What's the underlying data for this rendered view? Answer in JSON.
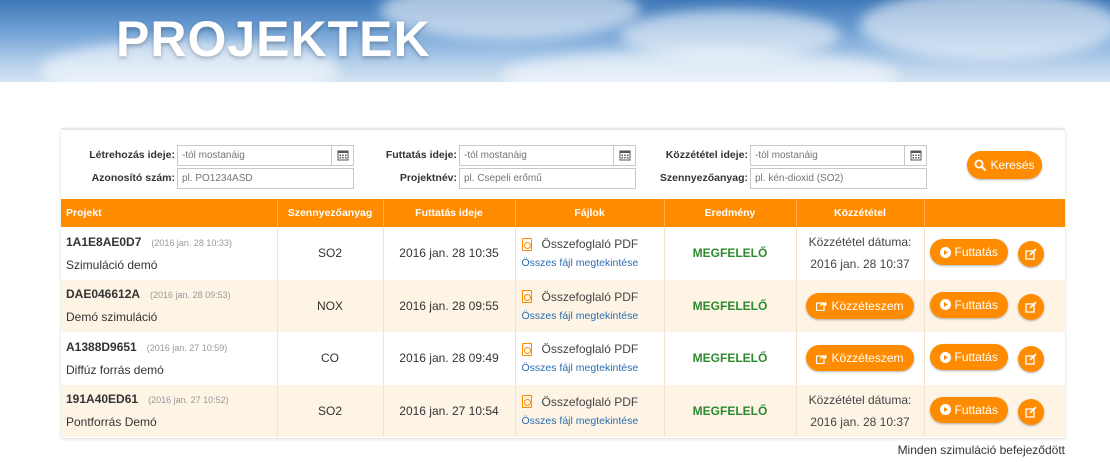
{
  "header": {
    "title": "PROJEKTEK"
  },
  "filters": {
    "created_label": "Létrehozás ideje:",
    "created_placeholder": "-tól mostanáig",
    "id_label": "Azonosító szám:",
    "id_placeholder": "pl. PO1234ASD",
    "run_label": "Futtatás ideje:",
    "run_placeholder": "-tól mostanáig",
    "name_label": "Projektnév:",
    "name_placeholder": "pl. Csepeli erőmű",
    "pub_label": "Közzététel ideje:",
    "pub_placeholder": "-tól mostanáig",
    "pollutant_label": "Szennyezőanyag:",
    "pollutant_placeholder": "pl. kén-dioxid (SO2)",
    "search_label": "Keresés"
  },
  "table": {
    "headers": {
      "project": "Projekt",
      "pollutant": "Szennyezőanyag",
      "run_time": "Futtatás ideje",
      "files": "Fájlok",
      "result": "Eredmény",
      "publication": "Közzététel"
    },
    "rows": [
      {
        "id": "1A1E8AE0D7",
        "created": "(2016 jan. 28 10:33)",
        "name": "Szimuláció demó",
        "pollutant": "SO2",
        "run_time": "2016 jan. 28 10:35",
        "pdf": "Összefoglaló PDF",
        "all_files": "Összes fájl megtekintése",
        "result": "MEGFELELŐ",
        "pub_line1": "Közzététel dátuma:",
        "pub_line2": "2016 jan. 28 10:37",
        "run_button": "Futtatás"
      },
      {
        "id": "DAE046612A",
        "created": "(2016 jan. 28 09:53)",
        "name": "Demó szimuláció",
        "pollutant": "NOX",
        "run_time": "2016 jan. 28 09:55",
        "pdf": "Összefoglaló PDF",
        "all_files": "Összes fájl megtekintése",
        "result": "MEGFELELŐ",
        "publish_button": "Közzéteszem",
        "run_button": "Futtatás"
      },
      {
        "id": "A1388D9651",
        "created": "(2016 jan. 27 10:59)",
        "name": "Diffúz forrás demó",
        "pollutant": "CO",
        "run_time": "2016 jan. 28 09:49",
        "pdf": "Összefoglaló PDF",
        "all_files": "Összes fájl megtekintése",
        "result": "MEGFELELŐ",
        "publish_button": "Közzéteszem",
        "run_button": "Futtatás"
      },
      {
        "id": "191A40ED61",
        "created": "(2016 jan. 27 10:52)",
        "name": "Pontforrás Demó",
        "pollutant": "SO2",
        "run_time": "2016 jan. 27 10:54",
        "pdf": "Összefoglaló PDF",
        "all_files": "Összes fájl megtekintése",
        "result": "MEGFELELŐ",
        "pub_line1": "Közzététel dátuma:",
        "pub_line2": "2016 jan. 28 10:37",
        "run_button": "Futtatás"
      }
    ]
  },
  "status": "Minden szimuláció befejeződött",
  "colors": {
    "accent": "#ff8c00",
    "result": "#2d8a2d",
    "link": "#2b6cb0"
  },
  "icons": [
    "calendar-icon",
    "search-icon",
    "pdf-icon",
    "play-icon",
    "share-icon",
    "edit-icon"
  ]
}
